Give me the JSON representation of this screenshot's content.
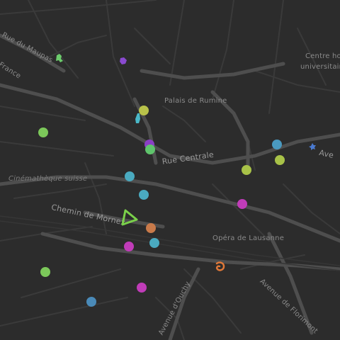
{
  "map": {
    "colors": {
      "background": "#2c2c2c",
      "road_major": "#555555",
      "road_minor": "#3d3d3d",
      "label": "#8a8a8a"
    },
    "labels": {
      "rue_du_maupas": "Rue du Maupas",
      "france": "France",
      "palais_de_rumine": "Palais de Rumine",
      "centre_hospitalier": "Centre ho",
      "universitaire": "universitaire",
      "rue_centrale": "Rue Centrale",
      "avenue_right": "Ave",
      "cinematheque": "Cinémathèque suisse",
      "chemin_de_mornex": "Chemin de Mornex",
      "opera": "Opéra de Lausanne",
      "avenue_ouchy": "Avenue d'Ouchy",
      "avenue_florimont": "Avenue de Florimont"
    },
    "markers": {
      "circles": [
        {
          "name": "marker-green-1",
          "color": "#7cc85a"
        },
        {
          "name": "marker-yellow-1",
          "color": "#b8c24a"
        },
        {
          "name": "marker-purple-1",
          "color": "#8a3fc4"
        },
        {
          "name": "marker-green-2",
          "color": "#5fc46c"
        },
        {
          "name": "marker-cyan-1",
          "color": "#4aaac0"
        },
        {
          "name": "marker-cyan-2",
          "color": "#4aaac0"
        },
        {
          "name": "marker-yellow-2",
          "color": "#a8c248"
        },
        {
          "name": "marker-yellow-3",
          "color": "#a8c248"
        },
        {
          "name": "marker-blue-1",
          "color": "#4a9ac0"
        },
        {
          "name": "marker-magenta-1",
          "color": "#c03cb8"
        },
        {
          "name": "marker-orange-1",
          "color": "#c97a4a"
        },
        {
          "name": "marker-cyan-3",
          "color": "#4aaac0"
        },
        {
          "name": "marker-magenta-2",
          "color": "#c03cb8"
        },
        {
          "name": "marker-green-3",
          "color": "#7cc85a"
        },
        {
          "name": "marker-magenta-3",
          "color": "#c03cb8"
        },
        {
          "name": "marker-blue-2",
          "color": "#4a8ab8"
        }
      ],
      "icons": [
        {
          "name": "green-blob-icon",
          "color": "#6ccc6c"
        },
        {
          "name": "purple-blob-icon",
          "color": "#8a4ad0"
        },
        {
          "name": "cyan-brush-icon",
          "color": "#4ab8c8"
        },
        {
          "name": "blue-star-icon",
          "color": "#4a7ad0"
        },
        {
          "name": "green-triangle-icon",
          "color": "#7ad04a"
        },
        {
          "name": "orange-swirl-icon",
          "color": "#e07838"
        }
      ]
    }
  }
}
